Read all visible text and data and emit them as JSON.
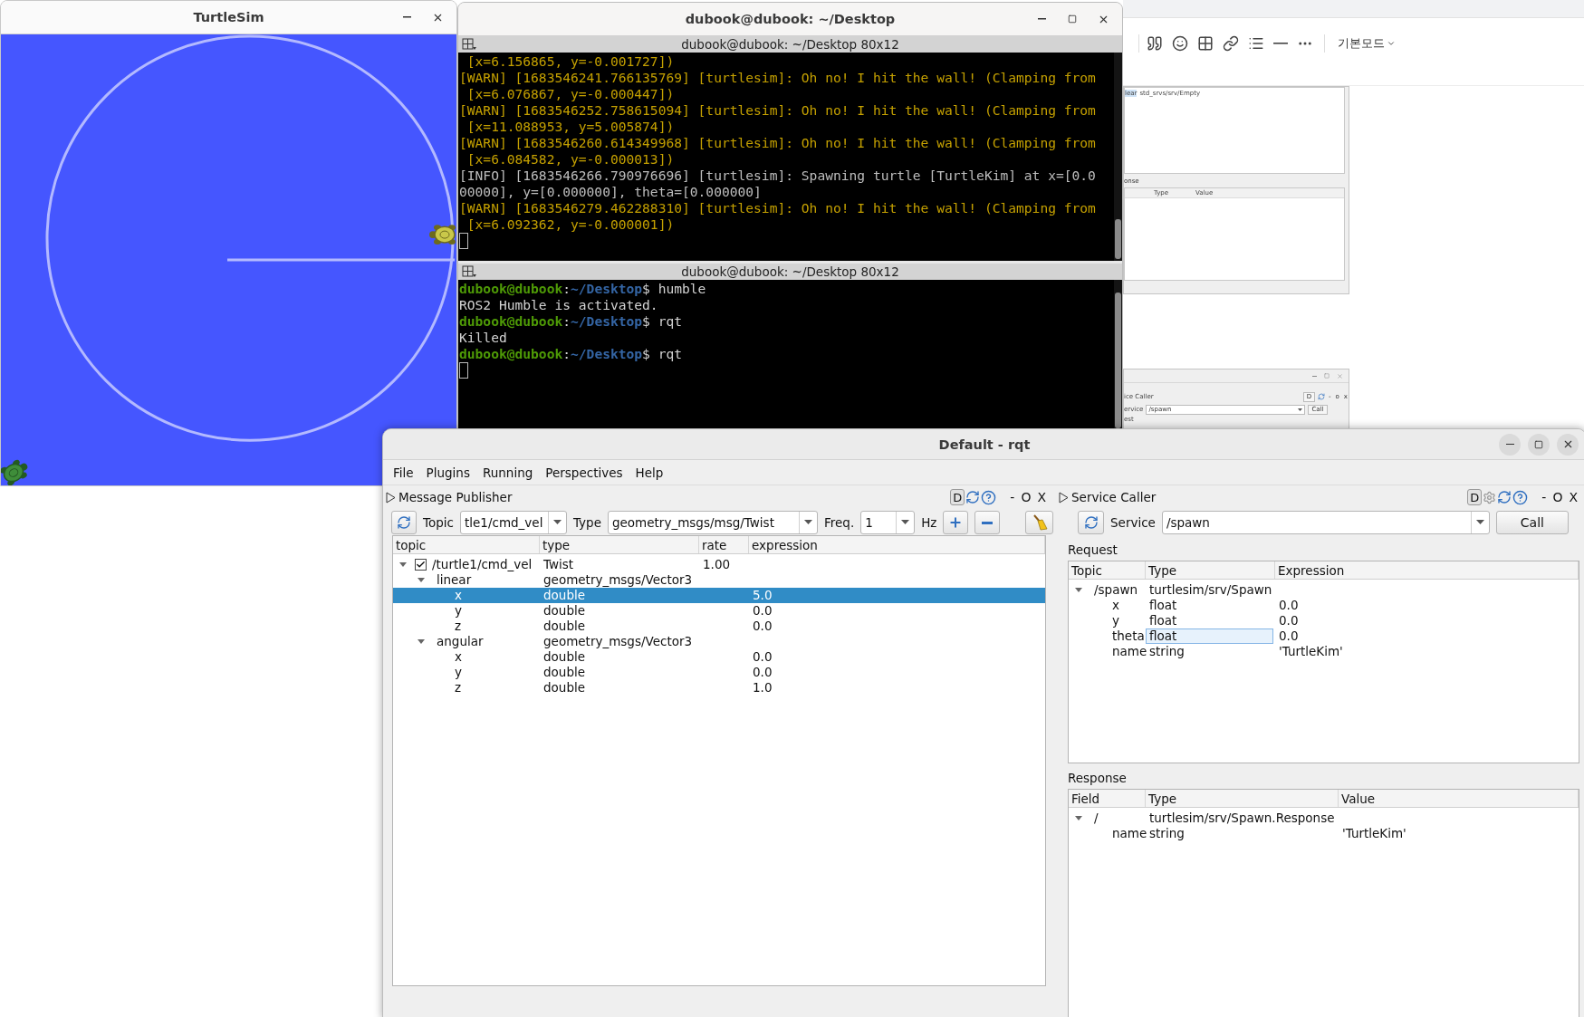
{
  "turtlesim": {
    "title": "TurtleSim"
  },
  "terminal": {
    "title": "dubook@dubook: ~/Desktop",
    "panes": [
      {
        "title": "dubook@dubook: ~/Desktop 80x12",
        "lines": [
          {
            "kind": "warn",
            "text": " [x=6.156865, y=-0.001727])"
          },
          {
            "kind": "warn",
            "text": "[WARN] [1683546241.766135769] [turtlesim]: Oh no! I hit the wall! (Clamping from"
          },
          {
            "kind": "warn",
            "text": " [x=6.076867, y=-0.000447])"
          },
          {
            "kind": "warn",
            "text": "[WARN] [1683546252.758615094] [turtlesim]: Oh no! I hit the wall! (Clamping from"
          },
          {
            "kind": "warn",
            "text": " [x=11.088953, y=5.005874])"
          },
          {
            "kind": "warn",
            "text": "[WARN] [1683546260.614349968] [turtlesim]: Oh no! I hit the wall! (Clamping from"
          },
          {
            "kind": "warn",
            "text": " [x=6.084582, y=-0.000013])"
          },
          {
            "kind": "info",
            "text": "[INFO] [1683546266.790976696] [turtlesim]: Spawning turtle [TurtleKim] at x=[0.0"
          },
          {
            "kind": "info",
            "text": "00000], y=[0.000000], theta=[0.000000]"
          },
          {
            "kind": "warn",
            "text": "[WARN] [1683546279.462288310] [turtlesim]: Oh no! I hit the wall! (Clamping from"
          },
          {
            "kind": "warn",
            "text": " [x=6.092362, y=-0.000001])"
          }
        ]
      },
      {
        "title": "dubook@dubook: ~/Desktop 80x12",
        "lines": [
          {
            "kind": "prompt",
            "user": "dubook@dubook",
            "sep": ":",
            "path": "~/Desktop",
            "command": "$ humble"
          },
          {
            "kind": "output",
            "text": "ROS2 Humble is activated."
          },
          {
            "kind": "prompt",
            "user": "dubook@dubook",
            "sep": ":",
            "path": "~/Desktop",
            "command": "$ rqt"
          },
          {
            "kind": "output",
            "text": "Killed"
          },
          {
            "kind": "prompt",
            "user": "dubook@dubook",
            "sep": ":",
            "path": "~/Desktop",
            "command": "$ rqt"
          }
        ]
      }
    ]
  },
  "browser": {
    "mode": "기본모드",
    "image_1": {
      "row": {
        "name": "lear",
        "type": "std_srvs/srv/Empty"
      },
      "section": "onse",
      "columns": [
        "Type",
        "Value"
      ]
    },
    "image_2": {
      "title": "ice Caller",
      "badge": "D",
      "dock_buttons": [
        "-",
        "o",
        "x"
      ],
      "service_label": "ervice",
      "service_value": "/spawn",
      "call": "Call",
      "section": "est"
    }
  },
  "rqt": {
    "title": "Default - rqt",
    "menu": [
      "File",
      "Plugins",
      "Running",
      "Perspectives",
      "Help"
    ],
    "publisher": {
      "title": "Message Publisher",
      "badge": "D",
      "dock_buttons": [
        "-",
        "O",
        "X"
      ],
      "topic_label": "Topic",
      "topic_value": "tle1/cmd_vel",
      "type_label": "Type",
      "type_value": "geometry_msgs/msg/Twist",
      "freq_label": "Freq.",
      "freq_value": "1",
      "unit": "Hz",
      "table": {
        "columns": [
          "topic",
          "type",
          "rate",
          "expression"
        ],
        "rows": [
          {
            "name": "/turtle1/cmd_vel",
            "type": "Twist",
            "rate": "1.00",
            "checked": true,
            "expanded": true,
            "selected": false,
            "children": [
              {
                "name": "linear",
                "type": "geometry_msgs/Vector3",
                "expanded": true,
                "selected": false,
                "children": [
                  {
                    "name": "x",
                    "type": "double",
                    "expression": "5.0",
                    "selected": true
                  },
                  {
                    "name": "y",
                    "type": "double",
                    "expression": "0.0",
                    "selected": false
                  },
                  {
                    "name": "z",
                    "type": "double",
                    "expression": "0.0",
                    "selected": false
                  }
                ]
              },
              {
                "name": "angular",
                "type": "geometry_msgs/Vector3",
                "expanded": true,
                "selected": false,
                "children": [
                  {
                    "name": "x",
                    "type": "double",
                    "expression": "0.0",
                    "selected": false
                  },
                  {
                    "name": "y",
                    "type": "double",
                    "expression": "0.0",
                    "selected": false
                  },
                  {
                    "name": "z",
                    "type": "double",
                    "expression": "1.0",
                    "selected": false
                  }
                ]
              }
            ]
          }
        ]
      }
    },
    "service_caller": {
      "title": "Service Caller",
      "badge": "D",
      "dock_buttons": [
        "-",
        "O",
        "X"
      ],
      "service_label": "Service",
      "service_value": "/spawn",
      "call": "Call",
      "request_label": "Request",
      "request": {
        "columns": [
          "Topic",
          "Type",
          "Expression"
        ],
        "rows": [
          {
            "name": "/spawn",
            "type": "turtlesim/srv/Spawn",
            "expanded": true,
            "focused": false,
            "children": [
              {
                "name": "x",
                "type": "float",
                "expression": "0.0",
                "focused": false
              },
              {
                "name": "y",
                "type": "float",
                "expression": "0.0",
                "focused": false
              },
              {
                "name": "theta",
                "type": "float",
                "expression": "0.0",
                "focused": true
              },
              {
                "name": "name",
                "type": "string",
                "expression": "'TurtleKim'",
                "focused": false
              }
            ]
          }
        ]
      },
      "response_label": "Response",
      "response": {
        "columns": [
          "Field",
          "Type",
          "Value"
        ],
        "rows": [
          {
            "name": "/",
            "type": "turtlesim/srv/Spawn.Response",
            "expanded": true,
            "children": [
              {
                "name": "name",
                "type": "string",
                "value": "'TurtleKim'"
              }
            ]
          }
        ]
      }
    }
  }
}
